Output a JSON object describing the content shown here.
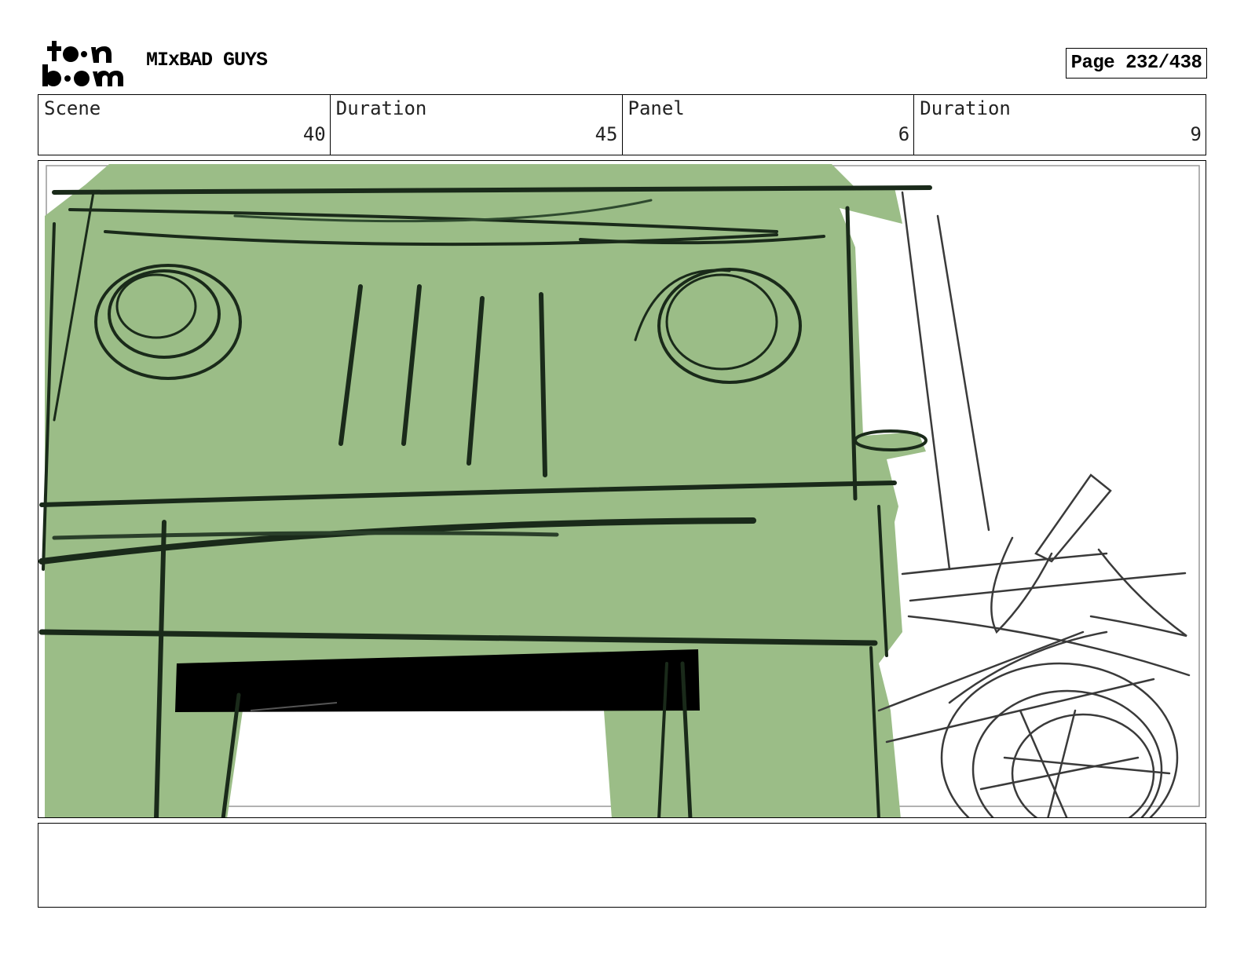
{
  "header": {
    "logo_text": "toonboom",
    "project_title": "MIxBAD GUYS",
    "page_label": "Page 232/438"
  },
  "info": [
    {
      "label": "Scene",
      "value": "40"
    },
    {
      "label": "Duration",
      "value": "45"
    },
    {
      "label": "Panel",
      "value": "6"
    },
    {
      "label": "Duration",
      "value": "9"
    }
  ],
  "panel": {
    "colors": {
      "truck_fill": "#9bbd87",
      "ink": "#1a2a1a",
      "grill": "#000000",
      "pencil": "#3a3a3a"
    }
  },
  "notes": {
    "text": ""
  }
}
